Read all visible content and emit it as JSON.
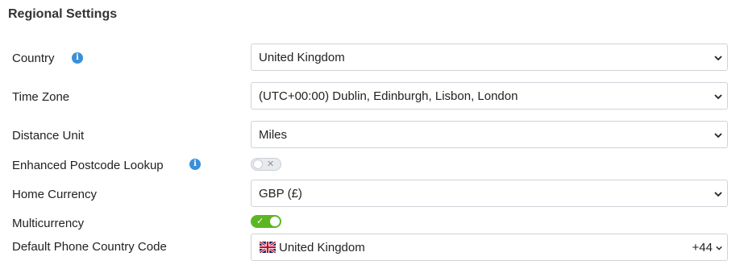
{
  "section_title": "Regional Settings",
  "fields": {
    "country": {
      "label": "Country",
      "value": "United Kingdom"
    },
    "time_zone": {
      "label": "Time Zone",
      "value": "(UTC+00:00) Dublin, Edinburgh, Lisbon, London"
    },
    "distance_unit": {
      "label": "Distance Unit",
      "value": "Miles"
    },
    "postcode_lookup": {
      "label": "Enhanced Postcode Lookup",
      "enabled": false,
      "mark": "✕"
    },
    "home_currency": {
      "label": "Home Currency",
      "value": "GBP (£)"
    },
    "multicurrency": {
      "label": "Multicurrency",
      "enabled": true,
      "mark": "✓"
    },
    "phone_code": {
      "label": "Default Phone Country Code",
      "country": "United Kingdom",
      "dial_code": "+44"
    }
  },
  "info_icon_glyph": "i",
  "colors": {
    "accent_info": "#3a8fd8",
    "toggle_on": "#5cb623",
    "border": "#cfd3d8"
  }
}
